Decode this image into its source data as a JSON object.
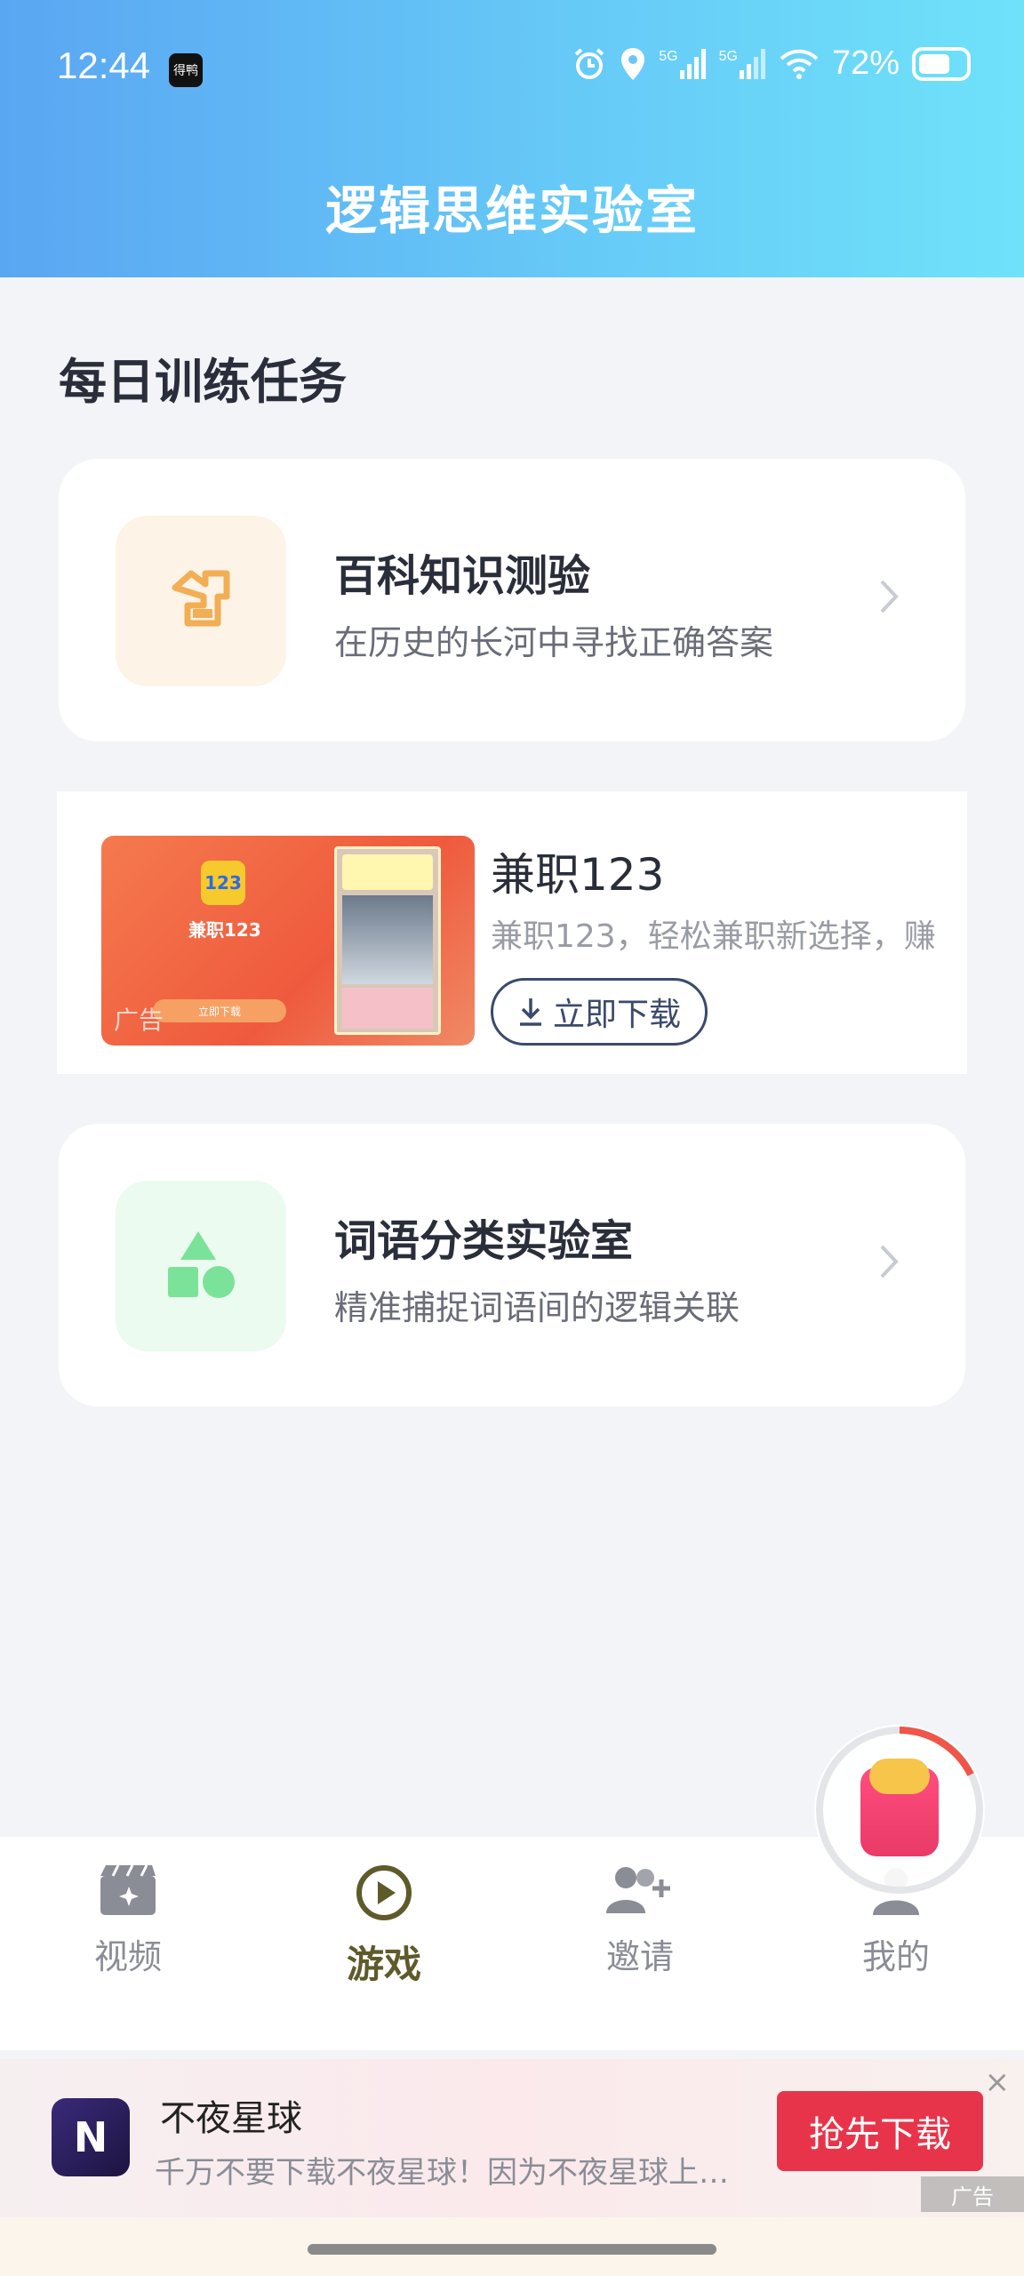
{
  "status_bar": {
    "time": "12:44",
    "app_badge": "得鸭",
    "signal_label_1": "5G",
    "signal_label_2": "5G",
    "battery_percent": "72%"
  },
  "header": {
    "title": "逻辑思维实验室"
  },
  "section": {
    "title": "每日训练任务"
  },
  "cards": [
    {
      "title": "百科知识测验",
      "subtitle": "在历史的长河中寻找正确答案",
      "icon": "puzzle-icon",
      "icon_bg": "#fdf3e6",
      "icon_color": "#f2ae55"
    },
    {
      "title": "词语分类实验室",
      "subtitle": "精准捕捉词语间的逻辑关联",
      "icon": "shapes-icon",
      "icon_bg": "#ebfbef",
      "icon_color": "#7be29a"
    }
  ],
  "ad": {
    "app_name": "兼职123",
    "description": "兼职123，轻松兼职新选择，赚",
    "download_label": "立即下载",
    "image_logo": "123",
    "image_logo_text": "兼职123",
    "image_mark": "广告",
    "image_button": "立即下载"
  },
  "tabs": [
    {
      "label": "视频",
      "icon": "video-icon",
      "active": false
    },
    {
      "label": "游戏",
      "icon": "play-icon",
      "active": true
    },
    {
      "label": "邀请",
      "icon": "invite-icon",
      "active": false
    },
    {
      "label": "我的",
      "icon": "profile-icon",
      "active": false
    }
  ],
  "bottom_ad": {
    "app_name": "不夜星球",
    "description": "千万不要下载不夜星球！因为不夜星球上…",
    "cta": "抢先下载",
    "ad_tag": "广告",
    "close": "×"
  },
  "colors": {
    "accent": "#5f5a2a",
    "cta_red": "#e8344a",
    "header_start": "#5aa6f2",
    "header_end": "#6fe2fa"
  }
}
